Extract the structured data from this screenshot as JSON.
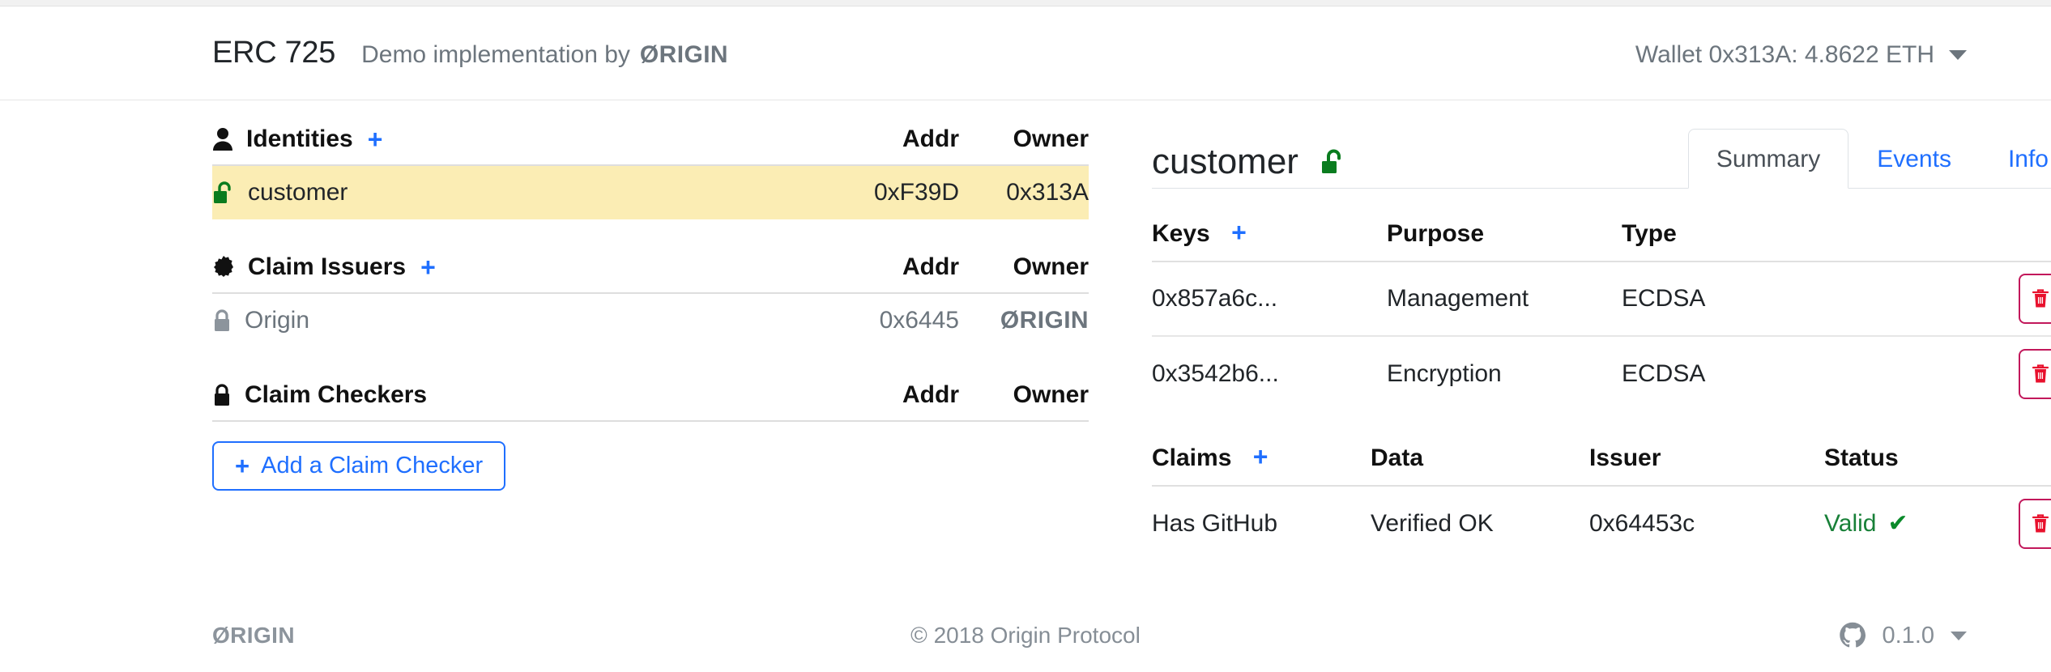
{
  "navbar": {
    "title": "ERC 725",
    "subtitle_prefix": "Demo implementation by",
    "brand_word": "ØRIGIN",
    "wallet_label": "Wallet 0x313A: 4.8622 ETH",
    "caret_icon": "chevron-down-icon"
  },
  "left": {
    "identities": {
      "icon": "person-icon",
      "title": "Identities",
      "add_icon": "plus-icon",
      "col_addr": "Addr",
      "col_owner": "Owner",
      "rows": [
        {
          "icon": "unlock-icon-green",
          "name": "customer",
          "addr": "0xF39D",
          "owner": "0x313A",
          "selected": true
        }
      ]
    },
    "claim_issuers": {
      "icon": "certificate-seal-icon",
      "title": "Claim Issuers",
      "add_icon": "plus-icon",
      "col_addr": "Addr",
      "col_owner": "Owner",
      "rows": [
        {
          "icon": "lock-icon-gray",
          "name": "Origin",
          "addr": "0x6445",
          "owner": "ØRIGIN",
          "selected": false
        }
      ]
    },
    "claim_checkers": {
      "icon": "lock-icon",
      "title": "Claim Checkers",
      "col_addr": "Addr",
      "col_owner": "Owner",
      "add_button": "Add a Claim Checker",
      "add_button_plus": "+"
    }
  },
  "right": {
    "title": "customer",
    "title_icon": "unlock-icon-green",
    "tabs": [
      {
        "label": "Summary",
        "active": true
      },
      {
        "label": "Events",
        "active": false
      },
      {
        "label": "Info",
        "active": false
      }
    ],
    "keys_table": {
      "heading": "Keys",
      "add_icon": "plus-icon",
      "columns": [
        "Keys",
        "Purpose",
        "Type"
      ],
      "rows": [
        {
          "key": "0x857a6c...",
          "purpose": "Management",
          "type": "ECDSA",
          "delete_icon": "trash-icon"
        },
        {
          "key": "0x3542b6...",
          "purpose": "Encryption",
          "type": "ECDSA",
          "delete_icon": "trash-icon"
        }
      ]
    },
    "claims_table": {
      "heading": "Claims",
      "add_icon": "plus-icon",
      "columns": [
        "Claims",
        "Data",
        "Issuer",
        "Status"
      ],
      "rows": [
        {
          "claim": "Has GitHub",
          "data": "Verified OK",
          "issuer": "0x64453c",
          "status": "Valid",
          "status_icon": "check-icon",
          "delete_icon": "trash-icon"
        }
      ]
    }
  },
  "footer": {
    "brand": "ØRIGIN",
    "copyright": "© 2018  Origin Protocol",
    "github_icon": "github-icon",
    "version": "0.1.0",
    "caret_icon": "chevron-down-icon"
  },
  "colors": {
    "accent_blue": "#1f6fff",
    "highlight_yellow": "#fbedb4",
    "green": "#0a8a2a",
    "valid_green": "#188038",
    "danger": "#c2185b",
    "muted": "#6c757d"
  }
}
